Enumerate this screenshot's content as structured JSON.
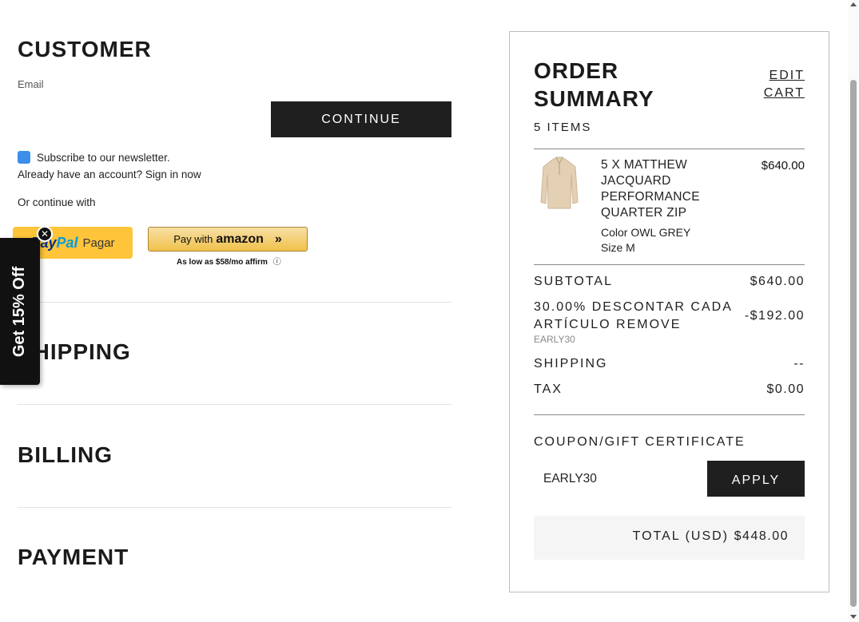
{
  "customer": {
    "title": "CUSTOMER",
    "email_label": "Email",
    "continue_label": "CONTINUE",
    "newsletter_label": "Subscribe to our newsletter.",
    "account_prefix": "Already have an account? ",
    "sign_in_label": "Sign in now",
    "or_continue": "Or continue with",
    "paypal": {
      "brand_part1": "Pay",
      "brand_part2": "Pal",
      "label": "Pagar"
    },
    "amazon": {
      "prefix": "Pay with",
      "brand": "amazon",
      "arrow": "»"
    },
    "affirm": {
      "text": "As low as $58/mo",
      "brand": "affirm",
      "info_icon": "ⓘ"
    }
  },
  "sections": {
    "shipping": "SHIPPING",
    "billing": "BILLING",
    "payment": "PAYMENT"
  },
  "promo": {
    "tab_text": "Get 15% Off",
    "close_icon": "✕"
  },
  "summary": {
    "title": "ORDER SUMMARY",
    "edit_cart": "EDIT CART",
    "items_count": "5 ITEMS",
    "product": {
      "name": "5 X MATTHEW JACQUARD PERFORMANCE QUARTER ZIP",
      "price": "$640.00",
      "color": "Color OWL GREY",
      "size": "Size M"
    },
    "subtotal_label": "SUBTOTAL",
    "subtotal_value": "$640.00",
    "discount_label": "30.00% DESCONTAR CADA ARTÍCULO REMOVE",
    "discount_value": "-$192.00",
    "discount_code": "EARLY30",
    "shipping_label": "SHIPPING",
    "shipping_value": "--",
    "tax_label": "TAX",
    "tax_value": "$0.00",
    "coupon_label": "COUPON/GIFT CERTIFICATE",
    "coupon_value": "EARLY30",
    "apply_label": "APPLY",
    "total_label": "TOTAL (USD)",
    "total_value": "$448.00"
  }
}
